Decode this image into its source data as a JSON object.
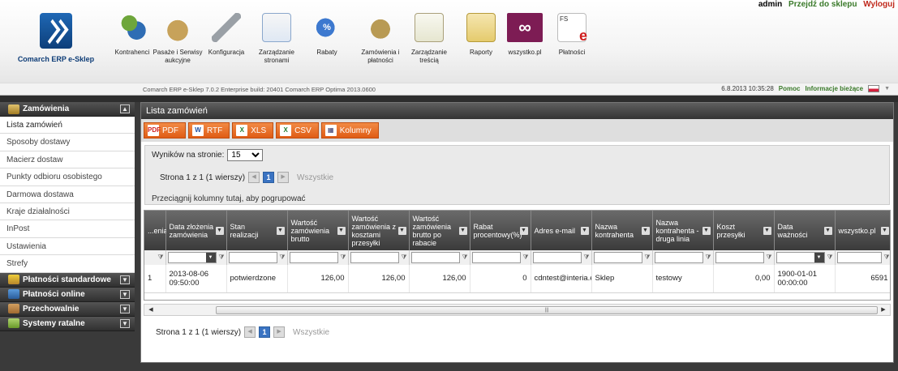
{
  "userbar": {
    "user": "admin",
    "shop_link": "Przejdź do sklepu",
    "logout": "Wyloguj"
  },
  "brand": {
    "name": "Comarch ERP e-Sklep"
  },
  "nav": [
    {
      "label": "Kontrahenci",
      "icon": "users-icon"
    },
    {
      "label": "Pasaże i Serwisy aukcyjne",
      "icon": "auction-icon"
    },
    {
      "label": "Konfiguracja",
      "icon": "wrench-icon"
    },
    {
      "label": "Zarządzanie stronami",
      "icon": "pages-icon"
    },
    {
      "label": "Rabaty",
      "icon": "discount-tag-icon"
    },
    {
      "label": "Zamówienia i płatności",
      "icon": "coins-icon"
    },
    {
      "label": "Zarządzanie treścią",
      "icon": "content-edit-icon"
    },
    {
      "label": "Raporty",
      "icon": "reports-icon"
    },
    {
      "label": "wszystko.pl",
      "icon": "wszystko-logo-icon",
      "glyph": "∞"
    },
    {
      "label": "Płatności",
      "icon": "fs-e-icon",
      "glyph": "FS",
      "glyph2": "e"
    }
  ],
  "status": {
    "build": "Comarch ERP e-Sklep 7.0.2 Enterprise build: 20401  Comarch ERP Optima 2013.0600",
    "datetime": "6.8.2013 10:35:28",
    "help": "Pomoc",
    "info": "Informacje bieżące"
  },
  "sidebar": {
    "sections": [
      {
        "label": "Zamówienia",
        "toggle": "▲",
        "expanded": true
      },
      {
        "label": "Płatności standardowe",
        "toggle": "▼"
      },
      {
        "label": "Płatności online",
        "toggle": "▼"
      },
      {
        "label": "Przechowalnie",
        "toggle": "▼"
      },
      {
        "label": "Systemy ratalne",
        "toggle": "▼"
      }
    ],
    "items": [
      "Lista zamówień",
      "Sposoby dostawy",
      "Macierz dostaw",
      "Punkty odbioru osobistego",
      "Darmowa dostawa",
      "Kraje działalności",
      "InPost",
      "Ustawienia",
      "Strefy"
    ]
  },
  "main": {
    "title": "Lista zamówień",
    "exports": [
      {
        "label": "PDF",
        "icon": "pdf-icon",
        "glyph": "PDF"
      },
      {
        "label": "RTF",
        "icon": "word-icon",
        "glyph": "W"
      },
      {
        "label": "XLS",
        "icon": "excel-icon",
        "glyph": "X"
      },
      {
        "label": "CSV",
        "icon": "csv-icon",
        "glyph": "X"
      },
      {
        "label": "Kolumny",
        "icon": "columns-icon",
        "glyph": "▦"
      }
    ],
    "per_page_label": "Wyników na stronie:",
    "per_page_value": "15",
    "pager_text": "Strona 1 z 1 (1 wierszy)",
    "current_page": "1",
    "all_label": "Wszystkie",
    "group_hint": "Przeciągnij kolumny tutaj, aby pogrupować",
    "columns": [
      "...enia",
      "Data złożenia zamówienia",
      "Stan realizacji",
      "Wartość zamówienia brutto",
      "Wartość zamówienia z kosztami przesyłki",
      "Wartość zamówienia brutto po rabacie",
      "Rabat procentowy(%)",
      "Adres e-mail",
      "Nazwa kontrahenta",
      "Nazwa kontrahenta - druga linia",
      "Koszt przesyłki",
      "Data ważności",
      "wszystko.pl"
    ],
    "rows": [
      [
        "1",
        "2013-08-06 09:50:00",
        "potwierdzone",
        "126,00",
        "126,00",
        "126,00",
        "0",
        "cdntest@interia.eu",
        "Sklep",
        "testowy",
        "0,00",
        "1900-01-01 00:00:00",
        "6591"
      ]
    ]
  }
}
